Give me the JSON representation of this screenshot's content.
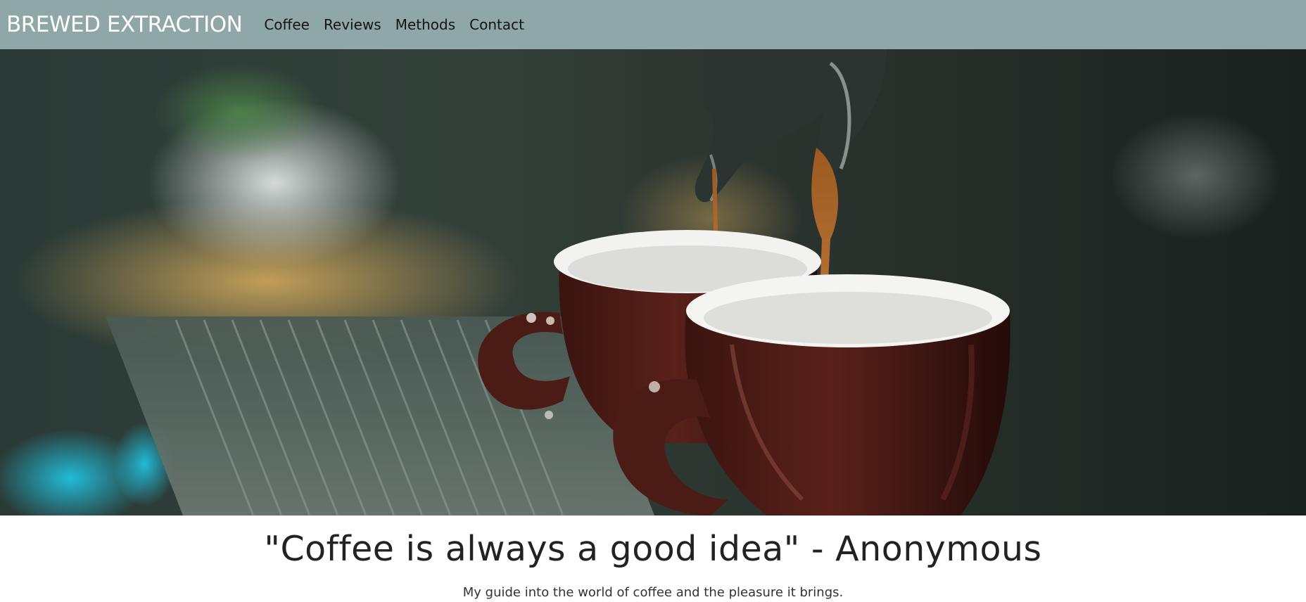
{
  "navbar": {
    "brand": "BREWED EXTRACTION",
    "links": [
      "Coffee",
      "Reviews",
      "Methods",
      "Contact"
    ],
    "background_color": "#8fa7a6"
  },
  "hero": {
    "image_subject": "espresso pouring into two brown cups"
  },
  "main": {
    "quote": "\"Coffee is always a good idea\" - Anonymous",
    "subtitle": "My guide into the world of coffee and the pleasure it brings."
  }
}
